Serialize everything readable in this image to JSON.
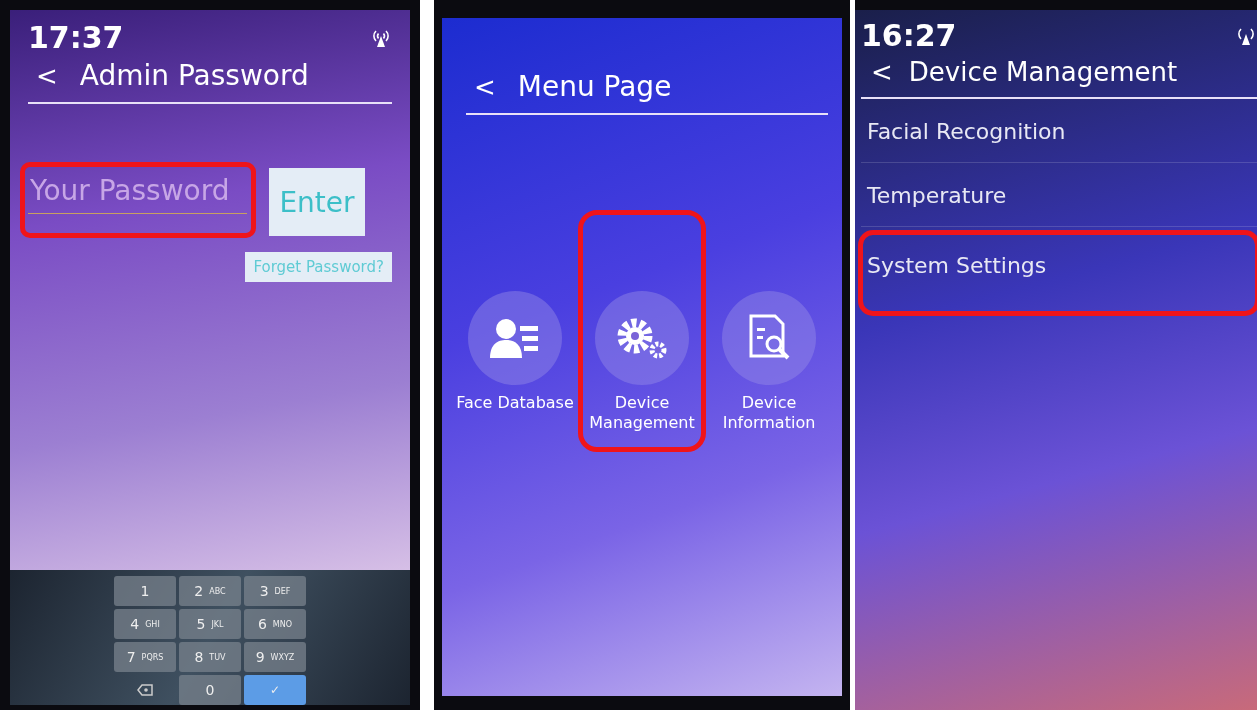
{
  "panels": [
    {
      "kind": "password",
      "time": "17:37",
      "back": "<",
      "title": "Admin Password",
      "field": {
        "placeholder": "Your Password",
        "highlighted": true
      },
      "enter": "Enter",
      "forgot": "Forget Password?",
      "keys": [
        {
          "kind": "digit",
          "digit": "1"
        },
        {
          "kind": "digit",
          "digit": "2",
          "letters": "ABC"
        },
        {
          "kind": "digit",
          "digit": "3",
          "letters": "DEF"
        },
        {
          "kind": "digit",
          "digit": "4",
          "letters": "GHI"
        },
        {
          "kind": "digit",
          "digit": "5",
          "letters": "JKL"
        },
        {
          "kind": "digit",
          "digit": "6",
          "letters": "MNO"
        },
        {
          "kind": "digit",
          "digit": "7",
          "letters": "PQRS"
        },
        {
          "kind": "digit",
          "digit": "8",
          "letters": "TUV"
        },
        {
          "kind": "digit",
          "digit": "9",
          "letters": "WXYZ"
        },
        {
          "kind": "backspace"
        },
        {
          "kind": "digit",
          "digit": "0"
        },
        {
          "kind": "confirm",
          "digit": "✓"
        }
      ]
    },
    {
      "kind": "menu",
      "back": "<",
      "title": "Menu Page",
      "tiles": [
        {
          "kind": "person",
          "label": "Face Database",
          "highlighted": false
        },
        {
          "kind": "gears",
          "label": "Device Management",
          "highlighted": true
        },
        {
          "kind": "document",
          "label": "Device Information",
          "highlighted": false
        }
      ]
    },
    {
      "kind": "list",
      "time": "16:27",
      "back": "<",
      "title": "Device Management",
      "items": [
        {
          "label": "Facial Recognition",
          "highlighted": false
        },
        {
          "label": "Temperature",
          "highlighted": false
        },
        {
          "label": "System Settings",
          "highlighted": true
        }
      ]
    }
  ]
}
